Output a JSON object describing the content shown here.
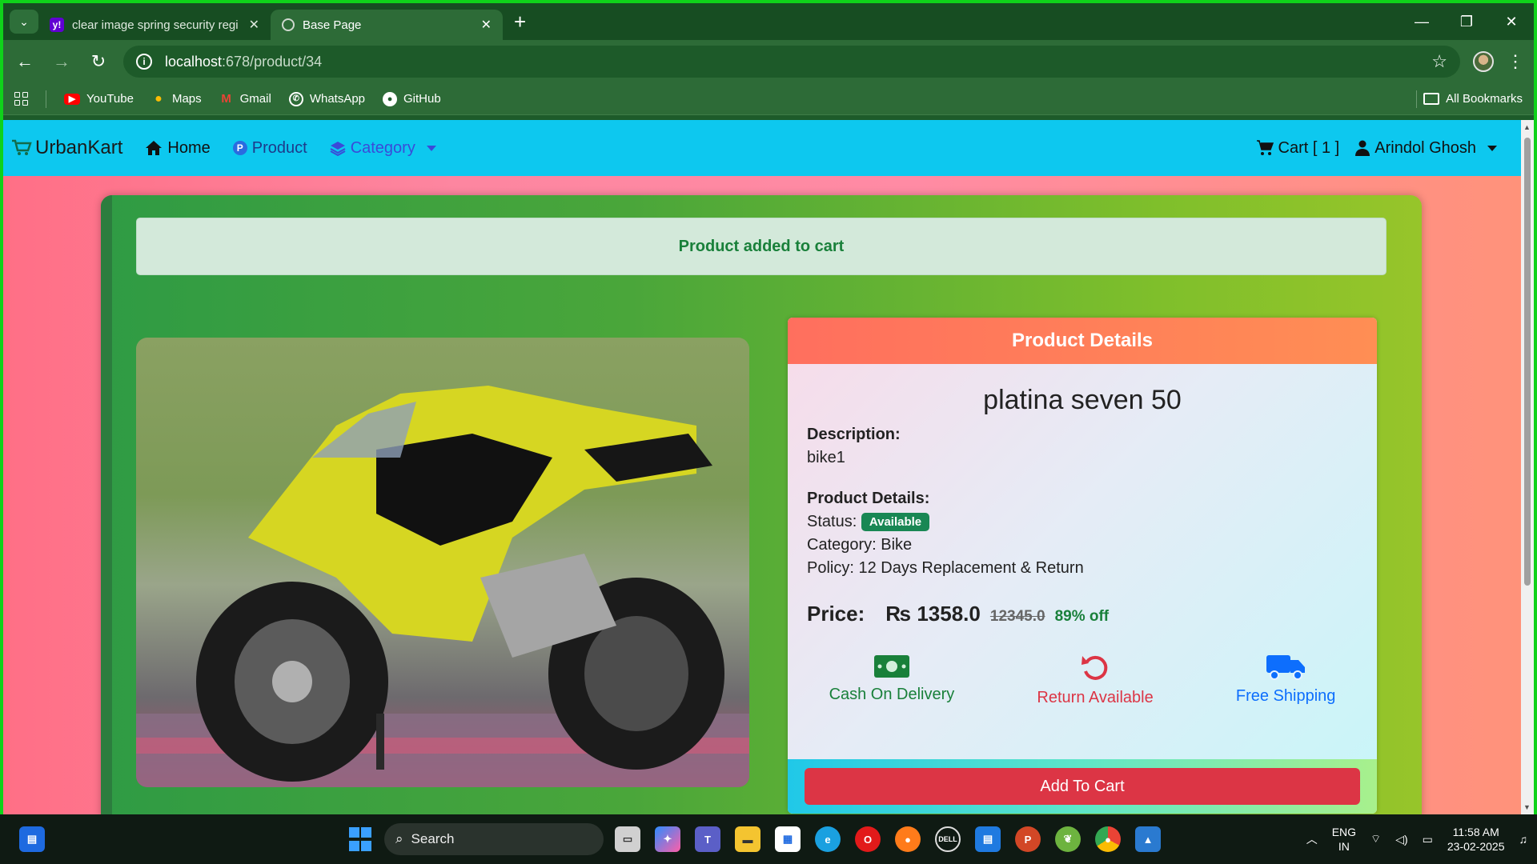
{
  "browser": {
    "tabs": [
      {
        "title": "clear image spring security regi",
        "favicon": "yahoo-icon",
        "active": false
      },
      {
        "title": "Base Page",
        "favicon": "globe-icon",
        "active": true
      }
    ],
    "url_host": "localhost",
    "url_path": ":678/product/34",
    "bookmarks": [
      {
        "label": "YouTube",
        "icon": "youtube-icon"
      },
      {
        "label": "Maps",
        "icon": "maps-icon"
      },
      {
        "label": "Gmail",
        "icon": "gmail-icon"
      },
      {
        "label": "WhatsApp",
        "icon": "whatsapp-icon"
      },
      {
        "label": "GitHub",
        "icon": "github-icon"
      }
    ],
    "all_bookmarks": "All Bookmarks"
  },
  "navbar": {
    "brand": "UrbanKart",
    "home": "Home",
    "product": "Product",
    "category": "Category",
    "cart": "Cart [ 1 ]",
    "user": "Arindol Ghosh",
    "colors": {
      "bar": "#0dc8ef",
      "category": "#3a4bd8"
    }
  },
  "alert": {
    "message": "Product added to cart"
  },
  "product": {
    "header": "Product Details",
    "name": "platina seven 50",
    "description_label": "Description:",
    "description": "bike1",
    "details_label": "Product Details:",
    "status_label": "Status:",
    "status": "Available",
    "category": "Category: Bike",
    "policy": "Policy: 12 Days Replacement & Return",
    "price_label": "Price:",
    "price": "₨ 1358.0",
    "original_price": "12345.0",
    "discount": "89% off",
    "features": [
      {
        "label": "Cash On Delivery",
        "icon": "money-icon",
        "color": "#19803a"
      },
      {
        "label": "Return Available",
        "icon": "return-icon",
        "color": "#dc3545"
      },
      {
        "label": "Free Shipping",
        "icon": "truck-icon",
        "color": "#0d6efd"
      }
    ],
    "add_to_cart": "Add To Cart"
  },
  "taskbar": {
    "search": "Search",
    "lang_1": "ENG",
    "lang_2": "IN",
    "time": "11:58 AM",
    "date": "23-02-2025"
  }
}
